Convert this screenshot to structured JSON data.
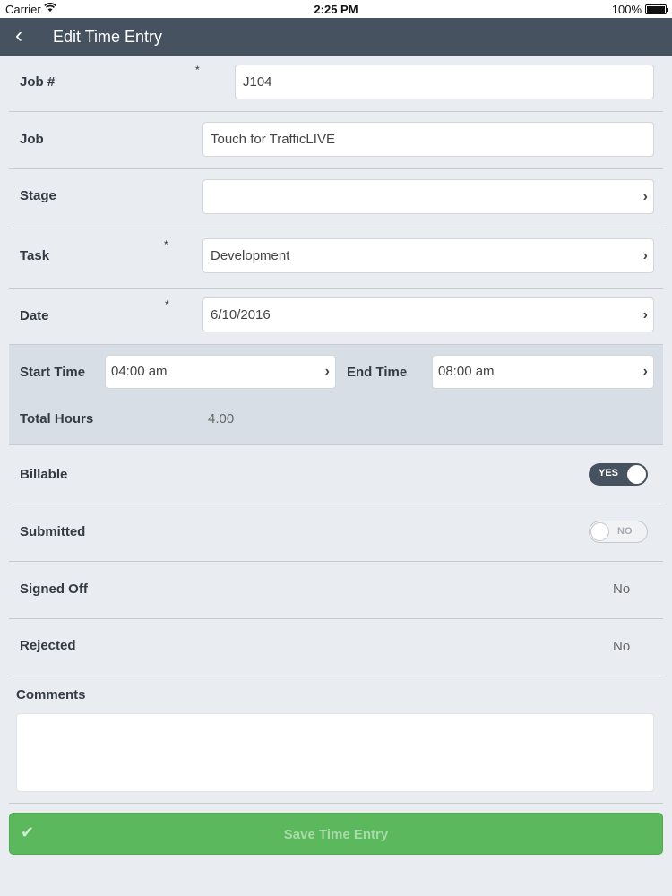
{
  "status_bar": {
    "carrier": "Carrier",
    "wifi_icon": "wifi-icon",
    "time": "2:25 PM",
    "battery": "100%"
  },
  "nav": {
    "back_icon": "chevron-left-icon",
    "back_glyph": "‹",
    "title": "Edit Time Entry"
  },
  "form": {
    "required_marker": "*",
    "chevron_glyph": "›",
    "job_number": {
      "label": "Job #",
      "value": "J104"
    },
    "job": {
      "label": "Job",
      "value": "Touch for TrafficLIVE"
    },
    "stage": {
      "label": "Stage",
      "value": ""
    },
    "task": {
      "label": "Task",
      "value": "Development"
    },
    "date": {
      "label": "Date",
      "value": "6/10/2016"
    },
    "start_time": {
      "label": "Start Time",
      "value": "04:00 am"
    },
    "end_time": {
      "label": "End Time",
      "value": "08:00 am"
    },
    "total_hours": {
      "label": "Total Hours",
      "value": "4.00"
    },
    "billable": {
      "label": "Billable",
      "state": "YES",
      "on": true
    },
    "submitted": {
      "label": "Submitted",
      "state": "NO",
      "on": false
    },
    "signed_off": {
      "label": "Signed Off",
      "value": "No"
    },
    "rejected": {
      "label": "Rejected",
      "value": "No"
    },
    "comments": {
      "label": "Comments",
      "value": ""
    }
  },
  "save_button": {
    "label": "Save Time Entry",
    "icon": "check-icon",
    "glyph": "✔",
    "color": "#5cb85c"
  },
  "colors": {
    "nav_bg": "#46525f",
    "page_bg": "#e9ecf0",
    "time_section_bg": "#d8dee5"
  }
}
